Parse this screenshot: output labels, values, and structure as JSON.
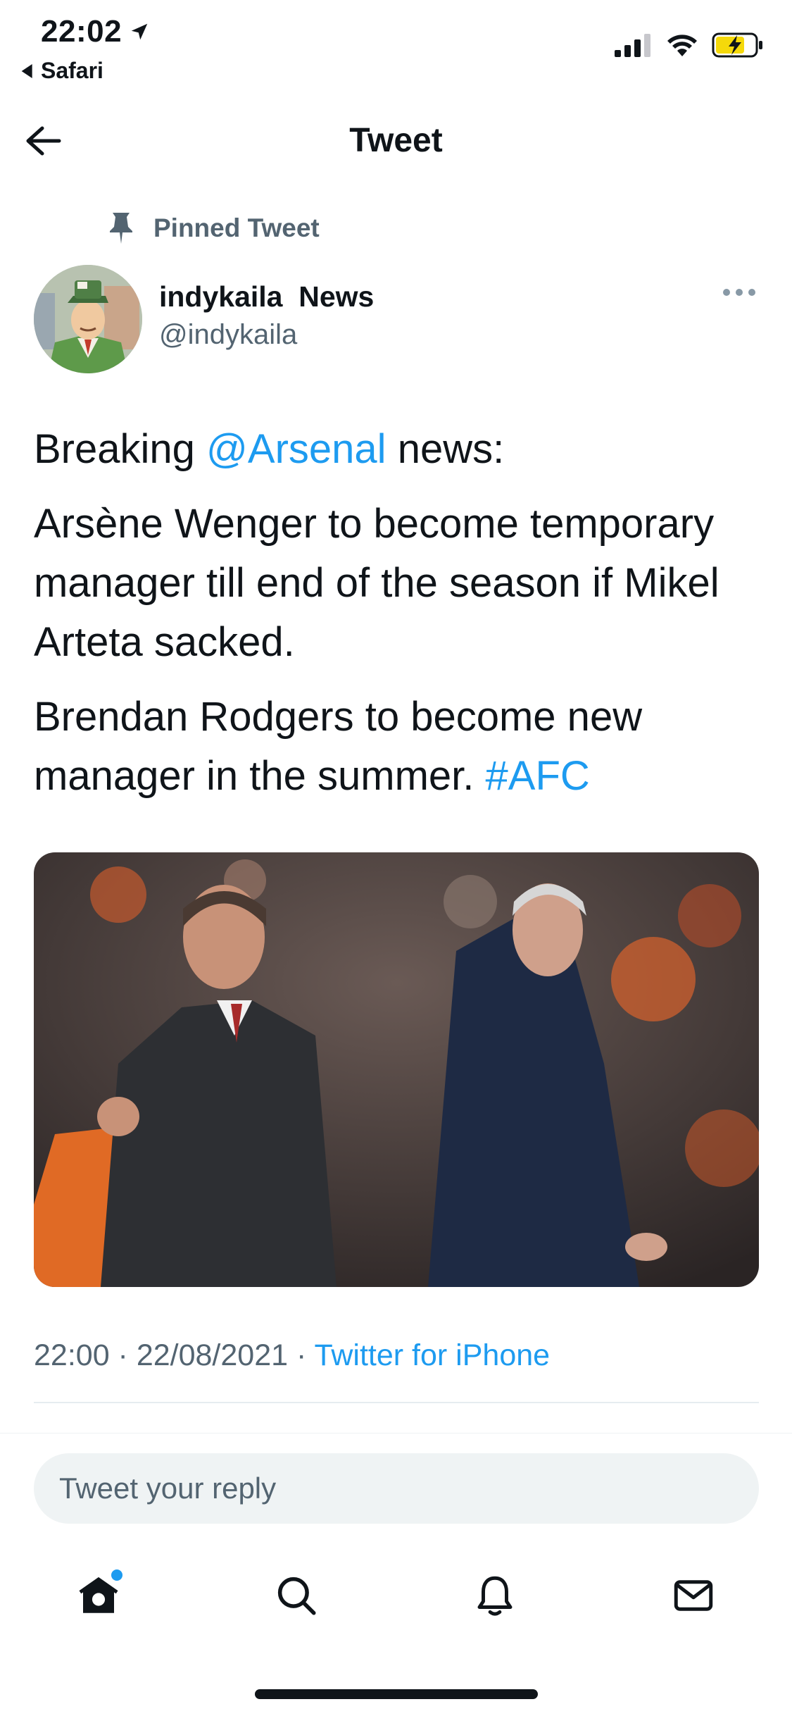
{
  "status_bar": {
    "time": "22:02",
    "back_app": "Safari",
    "icons": [
      "location-arrow-icon",
      "cellular-signal-icon",
      "wifi-icon",
      "battery-charging-icon"
    ]
  },
  "header": {
    "title": "Tweet",
    "back_icon": "arrow-left-icon"
  },
  "tweet": {
    "pinned_label": "Pinned Tweet",
    "author_name": "indykaila  News",
    "author_handle": "@indykaila",
    "text": {
      "p1_before": "Breaking ",
      "p1_mention": "@Arsenal",
      "p1_after": " news:",
      "p2": "Arsène Wenger to become temporary manager till end of the season if Mikel Arteta sacked.",
      "p3_before": "Brendan Rodgers to become new manager in the summer. ",
      "p3_hashtag": "#AFC"
    },
    "meta": {
      "time": "22:00",
      "separator": " · ",
      "date": "22/08/2021",
      "source": "Twitter for iPhone"
    }
  },
  "reply": {
    "placeholder": "Tweet your reply"
  },
  "tabbar": {
    "items": [
      "home-icon",
      "search-icon",
      "notifications-icon",
      "messages-icon"
    ]
  },
  "colors": {
    "accent": "#1d9bf0",
    "text_primary": "#0f1419",
    "text_secondary": "#536471",
    "input_bg": "#eff3f4"
  }
}
